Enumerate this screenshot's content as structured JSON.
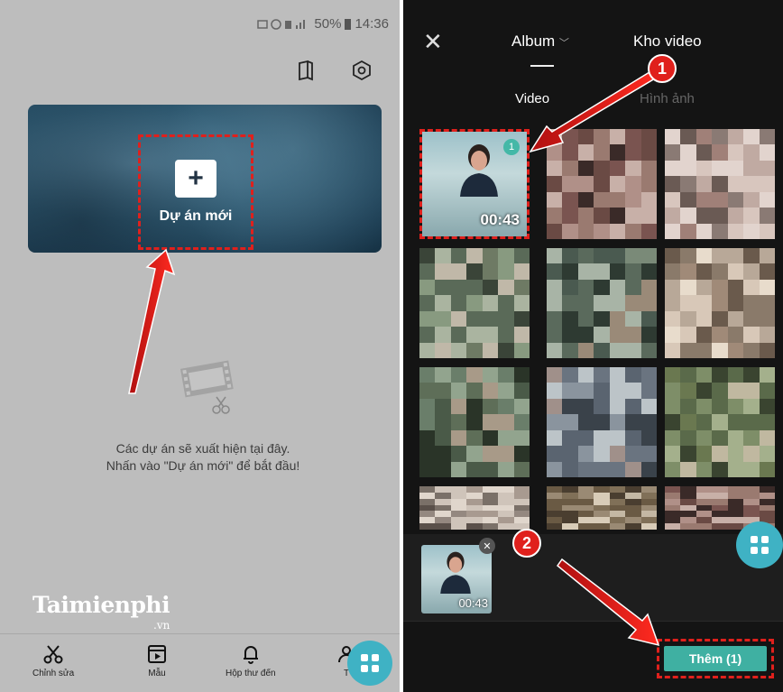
{
  "left": {
    "status_bar": "14:36",
    "status_battery": "50%",
    "new_project_label": "Dự án mới",
    "empty_line1": "Các dự án sẽ xuất hiện tại đây.",
    "empty_line2": "Nhấn vào \"Dự án mới\" để bắt đầu!",
    "logo": "Taimienphi",
    "logo_sub": ".vn",
    "nav": [
      {
        "label": "Chỉnh sửa",
        "icon": "scissors-icon"
      },
      {
        "label": "Mẫu",
        "icon": "template-icon"
      },
      {
        "label": "Hộp thư đến",
        "icon": "bell-icon"
      },
      {
        "label": "T",
        "icon": "profile-icon"
      }
    ]
  },
  "right": {
    "tab_album": "Album",
    "tab_kho": "Kho video",
    "sub_video": "Video",
    "sub_hinh": "Hình ảnh",
    "selected_duration": "00:43",
    "selected_badge": "1",
    "tray_duration": "00:43",
    "add_button": "Thêm (1)"
  },
  "annotations": {
    "step1": "1",
    "step2": "2"
  },
  "colors": {
    "accent": "#3fb2c4",
    "highlight": "#e0201c",
    "add": "#3fb0a2"
  }
}
